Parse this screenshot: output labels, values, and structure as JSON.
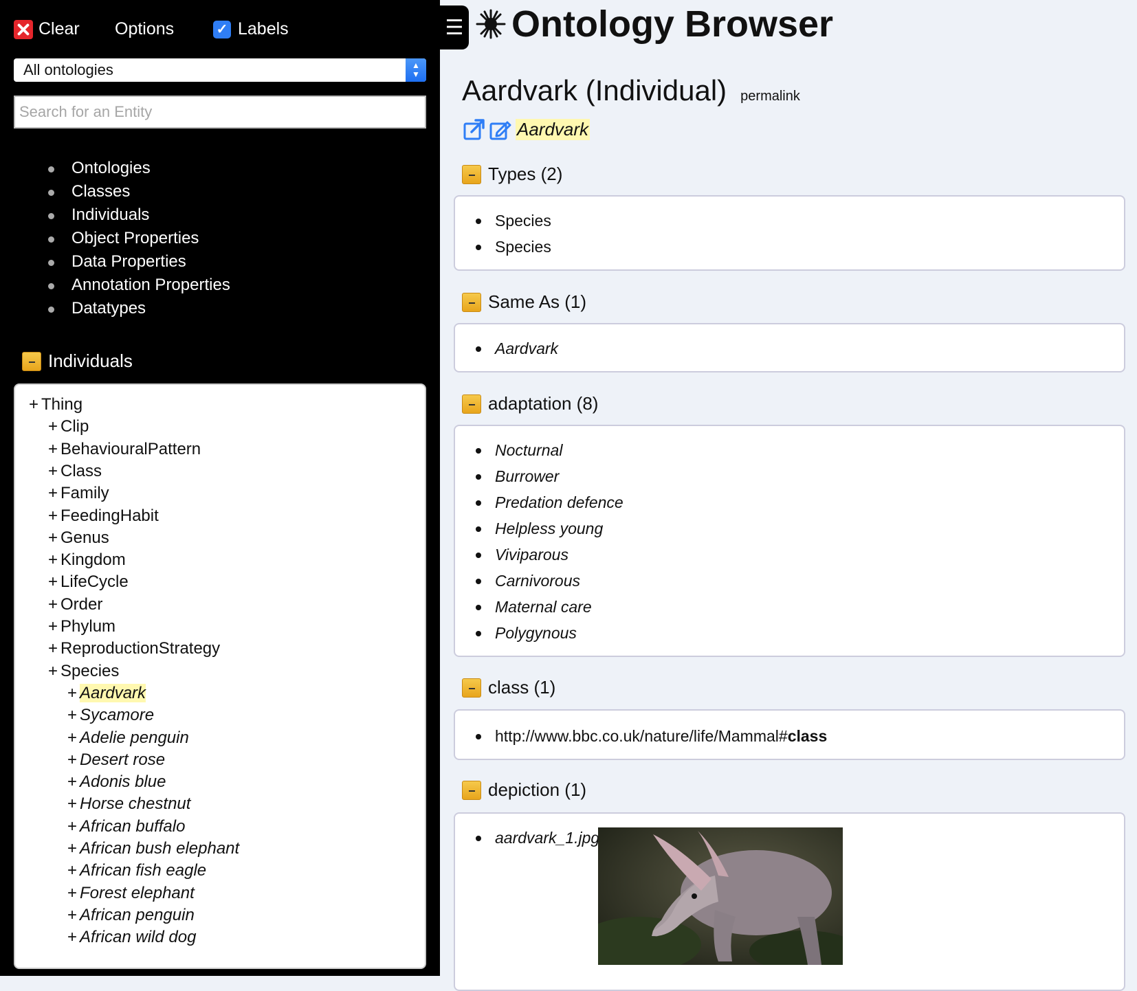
{
  "sidebar": {
    "clear_label": "Clear",
    "options_label": "Options",
    "labels_label": "Labels",
    "ontology_select": "All ontologies",
    "search_placeholder": "Search for an Entity",
    "nav_items": [
      "Ontologies",
      "Classes",
      "Individuals",
      "Object Properties",
      "Data Properties",
      "Annotation Properties",
      "Datatypes"
    ],
    "section_title": "Individuals",
    "tree": [
      {
        "label": "Thing",
        "level": 0,
        "italic": false
      },
      {
        "label": "Clip",
        "level": 1,
        "italic": false
      },
      {
        "label": "BehaviouralPattern",
        "level": 1,
        "italic": false
      },
      {
        "label": "Class",
        "level": 1,
        "italic": false
      },
      {
        "label": "Family",
        "level": 1,
        "italic": false
      },
      {
        "label": "FeedingHabit",
        "level": 1,
        "italic": false
      },
      {
        "label": "Genus",
        "level": 1,
        "italic": false
      },
      {
        "label": "Kingdom",
        "level": 1,
        "italic": false
      },
      {
        "label": "LifeCycle",
        "level": 1,
        "italic": false
      },
      {
        "label": "Order",
        "level": 1,
        "italic": false
      },
      {
        "label": "Phylum",
        "level": 1,
        "italic": false
      },
      {
        "label": "ReproductionStrategy",
        "level": 1,
        "italic": false
      },
      {
        "label": "Species",
        "level": 1,
        "italic": false
      },
      {
        "label": "Aardvark",
        "level": 2,
        "italic": true,
        "selected": true
      },
      {
        "label": "Sycamore",
        "level": 2,
        "italic": true
      },
      {
        "label": "Adelie penguin",
        "level": 2,
        "italic": true
      },
      {
        "label": "Desert rose",
        "level": 2,
        "italic": true
      },
      {
        "label": "Adonis blue",
        "level": 2,
        "italic": true
      },
      {
        "label": "Horse chestnut",
        "level": 2,
        "italic": true
      },
      {
        "label": "African buffalo",
        "level": 2,
        "italic": true
      },
      {
        "label": "African bush elephant",
        "level": 2,
        "italic": true
      },
      {
        "label": "African fish eagle",
        "level": 2,
        "italic": true
      },
      {
        "label": "Forest elephant",
        "level": 2,
        "italic": true
      },
      {
        "label": "African penguin",
        "level": 2,
        "italic": true
      },
      {
        "label": "African wild dog",
        "level": 2,
        "italic": true
      }
    ]
  },
  "main": {
    "app_title": "Ontology Browser",
    "entity_title": "Aardvark (Individual)",
    "permalink_label": "permalink",
    "entity_label": "Aardvark",
    "sections": [
      {
        "title": "Types (2)",
        "items": [
          "Species",
          "Species"
        ],
        "italic": false
      },
      {
        "title": "Same As (1)",
        "items": [
          "Aardvark"
        ],
        "italic": true
      },
      {
        "title": "adaptation (8)",
        "items": [
          "Nocturnal",
          "Burrower",
          "Predation defence",
          "Helpless young",
          "Viviparous",
          "Carnivorous",
          "Maternal care",
          "Polygynous"
        ],
        "italic": true
      },
      {
        "title": "class (1)",
        "items": [],
        "italic": false
      },
      {
        "title": "depiction (1)",
        "items": [
          "aardvark_1.jpg"
        ],
        "italic": true
      }
    ],
    "class_url_prefix": "http://www.bbc.co.uk/nature/life/Mammal#",
    "class_url_suffix": "class"
  },
  "colors": {
    "sidebar_bg": "#000000",
    "main_bg": "#eef2f8",
    "highlight": "#fff8b0",
    "icon_blue": "#2f7ef6",
    "clear_red": "#e5262c",
    "section_icon": "#f0b530"
  },
  "icons": [
    "close-icon",
    "checkbox-checked-icon",
    "select-arrows-icon",
    "minus-icon",
    "menu-icon",
    "asterisk-logo-icon",
    "open-external-icon",
    "edit-external-icon"
  ]
}
